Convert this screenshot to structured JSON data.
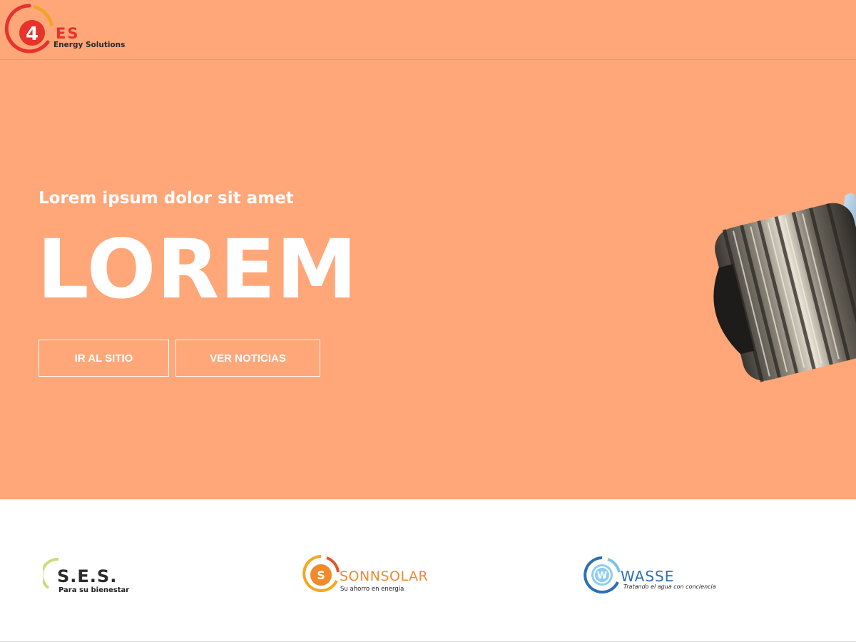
{
  "header": {
    "logo": {
      "digit": "4",
      "name": "ES",
      "tagline": "Energy Solutions"
    }
  },
  "hero": {
    "subtitle": "Lorem ipsum dolor sit amet",
    "title": "LOREM",
    "buttons": {
      "site": "IR AL SITIO",
      "news": "VER NOTICIAS"
    },
    "background_color": "#ffa779",
    "image_icon": "light-bulb-base-image"
  },
  "partners": [
    {
      "name": "S.E.S.",
      "tagline": "Para su bienestar",
      "icon_letter": "",
      "color": "#2c2c2c"
    },
    {
      "name": "SONNSOLAR",
      "tagline": "Su ahorro en energía",
      "icon_letter": "S",
      "color": "#f08a2a"
    },
    {
      "name": "WASSE",
      "tagline": "Tratando el agua con conciencia",
      "icon_letter": "W",
      "color": "#2c6fb4"
    }
  ]
}
